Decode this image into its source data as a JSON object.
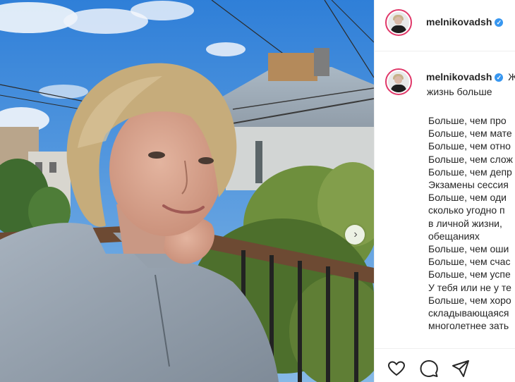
{
  "post": {
    "username": "melnikovadsh",
    "verified_mark": "✓",
    "next_icon": "chevron-right-icon"
  },
  "caption": {
    "username": "melnikovadsh",
    "first_line_tail": "Ж",
    "second_line": "жизнь больше",
    "lines": [
      "Больше, чем про",
      "Больше, чем мате",
      "Больше, чем отно",
      "Больше, чем слож",
      "Больше, чем депр",
      "Экзамены сессия",
      "Больше, чем оди",
      "сколько угодно п",
      "в личной жизни,",
      "обещаниях",
      "Больше, чем оши",
      "Больше, чем счас",
      "Больше, чем успе",
      "У тебя или не у те",
      "Больше, чем хоро",
      "складывающаяся",
      "многолетнее зать"
    ]
  },
  "actions": {
    "like_icon": "heart-icon",
    "comment_icon": "comment-icon",
    "share_icon": "send-icon"
  },
  "colors": {
    "avatar_ring": "#e0396a",
    "verified": "#3897f0",
    "text": "#262626",
    "divider": "#efefef"
  }
}
